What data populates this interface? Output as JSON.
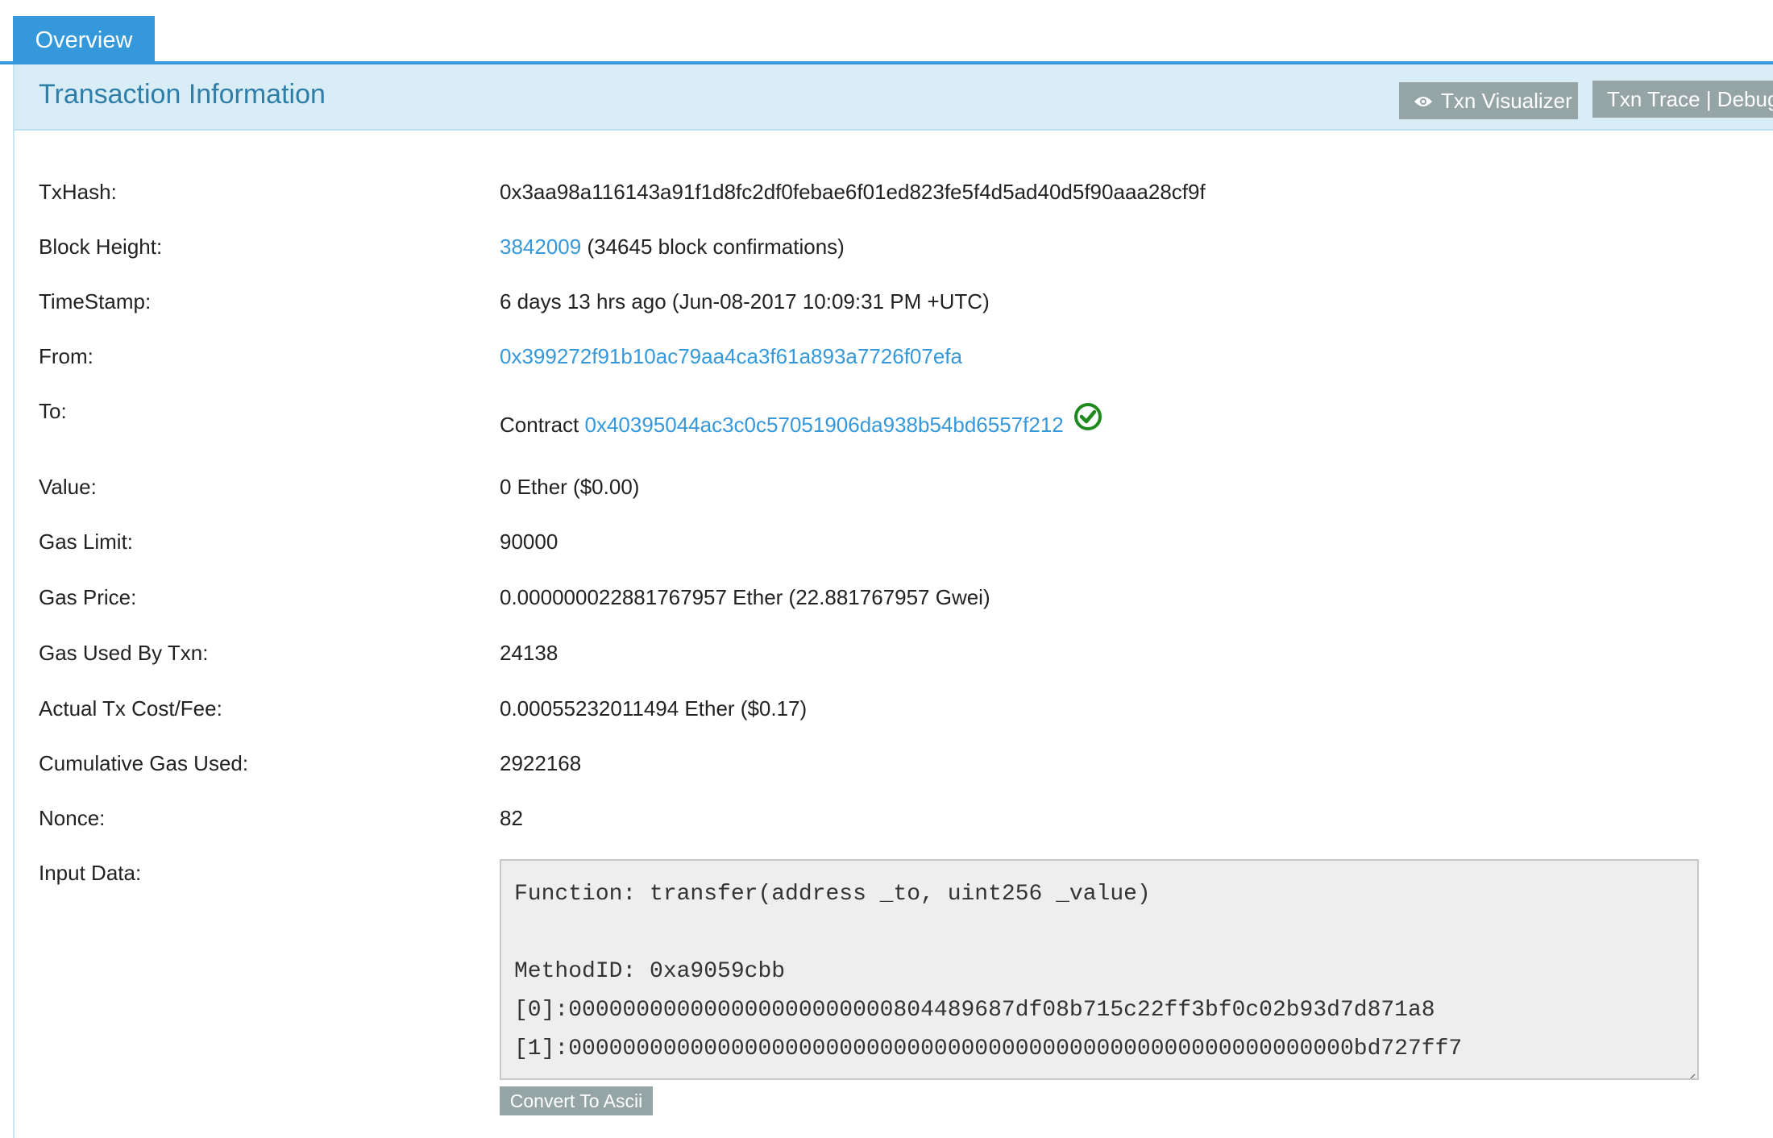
{
  "tabs": {
    "overview": "Overview"
  },
  "header": {
    "title": "Transaction Information",
    "visualizer_label": "Txn Visualizer",
    "trace_label": "Txn Trace | Debug"
  },
  "details": {
    "txhash": {
      "label": "TxHash:",
      "value": "0x3aa98a116143a91f1d8fc2df0febae6f01ed823fe5f4d5ad40d5f90aaa28cf9f"
    },
    "block": {
      "label": "Block Height:",
      "link": "3842009",
      "suffix": " (34645 block confirmations)"
    },
    "timestamp": {
      "label": "TimeStamp:",
      "value": "6 days 13 hrs ago (Jun-08-2017 10:09:31 PM +UTC)"
    },
    "from": {
      "label": "From:",
      "link": "0x399272f91b10ac79aa4ca3f61a893a7726f07efa"
    },
    "to": {
      "label": "To:",
      "prefix": "Contract ",
      "link": "0x40395044ac3c0c57051906da938b54bd6557f212"
    },
    "value": {
      "label": "Value:",
      "value": "0 Ether ($0.00)"
    },
    "gas_limit": {
      "label": "Gas Limit:",
      "value": "90000"
    },
    "gas_price": {
      "label": "Gas Price:",
      "value": "0.000000022881767957 Ether (22.881767957 Gwei)"
    },
    "gas_used": {
      "label": "Gas Used By Txn:",
      "value": "24138"
    },
    "tx_cost": {
      "label": "Actual Tx Cost/Fee:",
      "value": "0.00055232011494 Ether ($0.17)"
    },
    "cumulative_gas": {
      "label": "Cumulative Gas Used:",
      "value": "2922168"
    },
    "nonce": {
      "label": "Nonce:",
      "value": "82"
    },
    "input": {
      "label": "Input Data:",
      "function_line": "Function: transfer(address _to, uint256 _value)",
      "blank_line": "",
      "method_line": "MethodID: 0xa9059cbb",
      "param0": "[0]:000000000000000000000000804489687df08b715c22ff3bf0c02b93d7d871a8",
      "param1": "[1]:0000000000000000000000000000000000000000000000000000000000bd727ff7",
      "convert_label": "Convert To Ascii"
    }
  },
  "colors": {
    "accent": "#3498db",
    "header_bg": "#d9edf7",
    "button_gray": "#95a5a6",
    "verified_green": "#1e8a1e"
  }
}
